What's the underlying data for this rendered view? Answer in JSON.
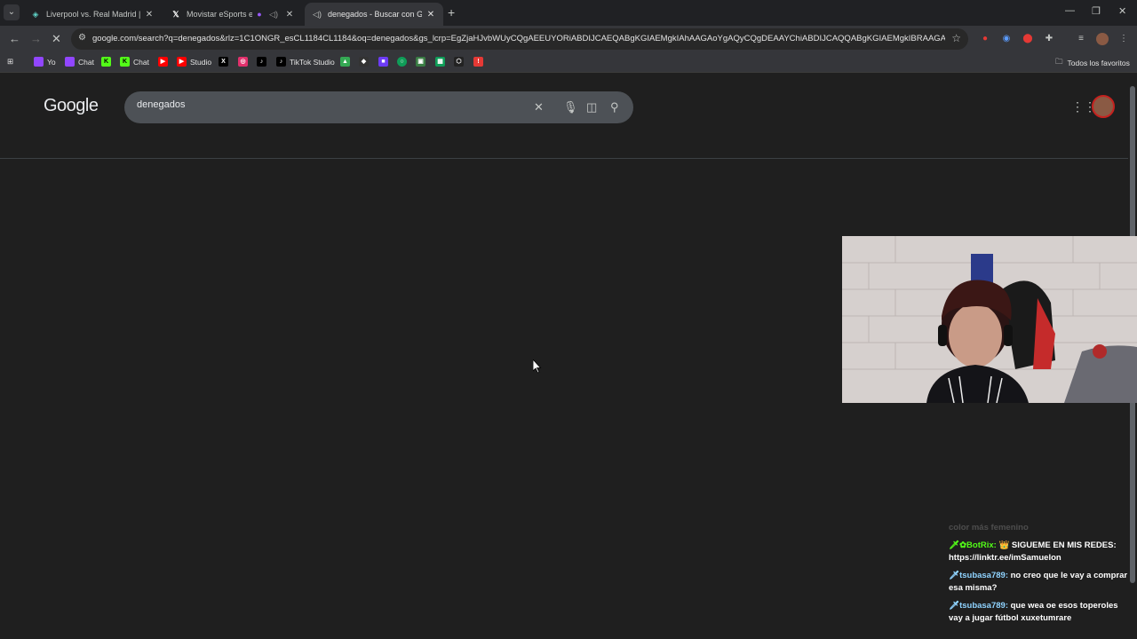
{
  "tabs": [
    {
      "title": "Liverpool vs. Real Madrid | Dis",
      "active": false
    },
    {
      "title": "Movistar eSports en X: \"",
      "active": false
    },
    {
      "title": "denegados - Buscar con Googl",
      "active": true
    }
  ],
  "omnibox": {
    "url": "google.com/search?q=denegados&rlz=1C1ONGR_esCL1184CL1184&oq=denegados&gs_lcrp=EgZjaHJvbWUyCQgAEEUYORiABDIJCAEQABgKGIAEMgkIAhAAGAoYgAQyCQgDEAAYChiABDIJCAQQABgKGIAEMgkIBRAAGAoYgAQyCQg..."
  },
  "bookmarks": {
    "items": [
      {
        "label": "Yo",
        "color": "#9146ff"
      },
      {
        "label": "Chat",
        "color": "#9146ff"
      },
      {
        "label": "",
        "color": "#53fc18"
      },
      {
        "label": "Chat",
        "color": "#53fc18"
      },
      {
        "label": "",
        "color": "#ff0000"
      },
      {
        "label": "Studio",
        "color": "#ff0000"
      },
      {
        "label": "",
        "color": "#000000"
      },
      {
        "label": "",
        "color": "#e1306c"
      },
      {
        "label": "",
        "color": "#000000"
      },
      {
        "label": "TikTok Studio",
        "color": "#000000"
      }
    ],
    "all_favorites": "Todos los favoritos"
  },
  "search": {
    "logo": "Google",
    "query": "denegados"
  },
  "chat": {
    "messages": [
      {
        "user": "",
        "text": "color más femenino",
        "faded": true,
        "user_color": "#888888"
      },
      {
        "user": "BotRix:",
        "text": "👑 SIGUEME EN MIS REDES: https://linktr.ee/imSamuelon",
        "faded": false,
        "user_color": "#53fc18"
      },
      {
        "user": "tsubasa789:",
        "text": "no creo que le vay a comprar esa misma?",
        "faded": false,
        "user_color": "#8fd3ff"
      },
      {
        "user": "tsubasa789:",
        "text": "que wea oe esos toperoles vay a jugar fútbol xuxetumrare",
        "faded": false,
        "user_color": "#8fd3ff"
      }
    ]
  }
}
